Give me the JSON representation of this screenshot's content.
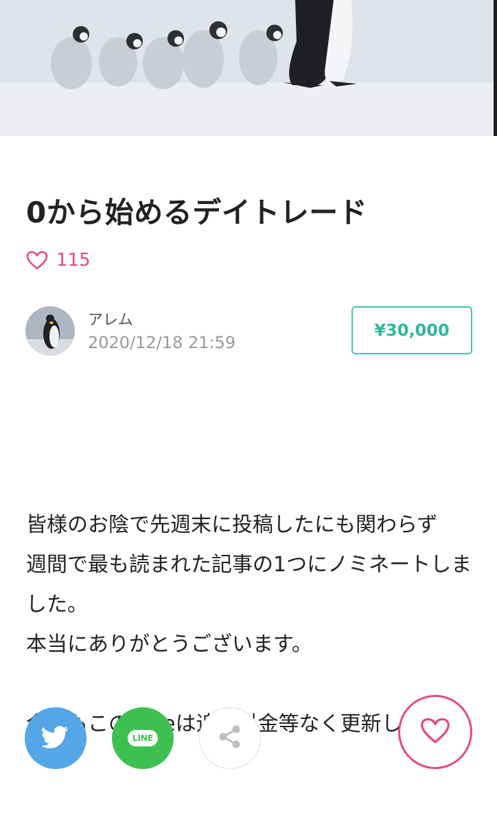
{
  "article": {
    "title": "0から始めるデイトレード",
    "like_count": "115",
    "author_name": "アレム",
    "published_at": "2020/12/18 21:59",
    "price_label": "¥30,000",
    "paragraphs": [
      "皆様のお陰で先週末に投稿したにも関わらず",
      "週間で最も読まれた記事の1つにノミネートしました。",
      "本当にありがとうございます。",
      "",
      "今後もこのnoteは追加料金等なく更新して"
    ]
  },
  "share": {
    "line_label": "LINE"
  },
  "colors": {
    "like_pink": "#e8497a",
    "price_green": "#3ec5a8",
    "twitter_blue": "#55a6e6",
    "line_green": "#3fc152"
  },
  "icons": {
    "likes": "heart-outline-icon",
    "twitter": "twitter-bird-icon",
    "line": "line-logo-icon",
    "share": "share-nodes-icon",
    "like_float": "heart-outline-icon"
  }
}
